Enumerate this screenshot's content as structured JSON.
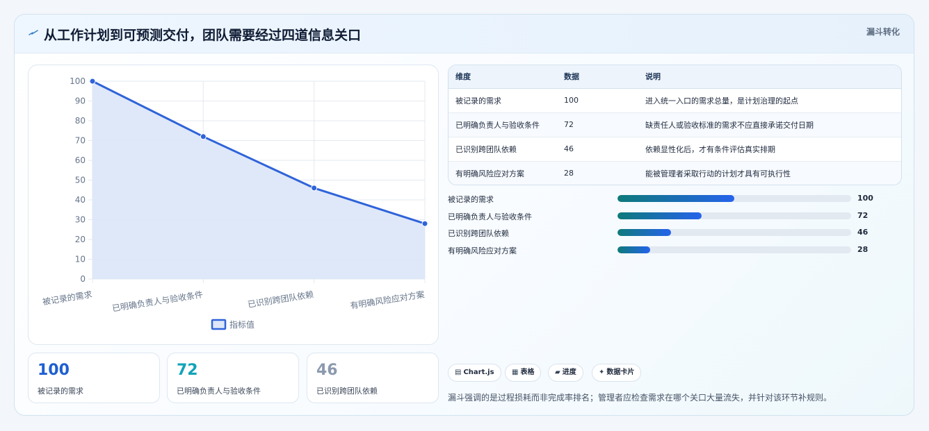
{
  "header": {
    "icon": "bolt-icon",
    "title": "从工作计划到可预测交付，团队需要经过四道信息关口",
    "tag": "漏斗转化"
  },
  "chart_data": {
    "type": "area",
    "categories": [
      "被记录的需求",
      "已明确负责人与验收条件",
      "已识别跨团队依赖",
      "有明确风险应对方案"
    ],
    "series": [
      {
        "name": "指标值",
        "values": [
          100,
          72,
          46,
          28
        ]
      }
    ],
    "ylim": [
      0,
      100
    ],
    "yticks": [
      "0",
      "10",
      "20",
      "30",
      "40",
      "50",
      "60",
      "70",
      "80",
      "90",
      "100"
    ],
    "legend_position": "bottom",
    "grid": true,
    "line_color": "#2f63d9",
    "fill_color": "#dde7f9"
  },
  "kpis": [
    {
      "value": "100",
      "label": "被记录的需求",
      "color": "#1f5fd1"
    },
    {
      "value": "72",
      "label": "已明确负责人与验收条件",
      "color": "#12a3b8"
    },
    {
      "value": "46",
      "label": "已识别跨团队依赖",
      "color": "#8c9aae"
    }
  ],
  "table": {
    "headers": [
      "维度",
      "数据",
      "说明"
    ],
    "rows": [
      [
        "被记录的需求",
        "100",
        "进入统一入口的需求总量，是计划治理的起点"
      ],
      [
        "已明确负责人与验收条件",
        "72",
        "缺责任人或验收标准的需求不应直接承诺交付日期"
      ],
      [
        "已识别跨团队依赖",
        "46",
        "依赖显性化后，才有条件评估真实排期"
      ],
      [
        "有明确风险应对方案",
        "28",
        "能被管理者采取行动的计划才具有可执行性"
      ]
    ]
  },
  "progress": [
    {
      "label": "被记录的需求",
      "value": 100,
      "fraction": 0.5
    },
    {
      "label": "已明确负责人与验收条件",
      "value": 72,
      "fraction": 0.36
    },
    {
      "label": "已识别跨团队依赖",
      "value": 46,
      "fraction": 0.23
    },
    {
      "label": "有明确风险应对方案",
      "value": 28,
      "fraction": 0.14
    }
  ],
  "chips": [
    {
      "icon": "chart-icon",
      "glyph": "▤",
      "label": "Chart.js"
    },
    {
      "icon": "table-icon",
      "glyph": "▦",
      "label": "表格"
    },
    {
      "icon": "progress-icon",
      "glyph": "▰",
      "label": "进度"
    },
    {
      "icon": "sparkle-icon",
      "glyph": "✦",
      "label": "数据卡片"
    }
  ],
  "note": "漏斗强调的是过程损耗而非完成率排名；管理者应检查需求在哪个关口大量流失，并针对该环节补规则。"
}
